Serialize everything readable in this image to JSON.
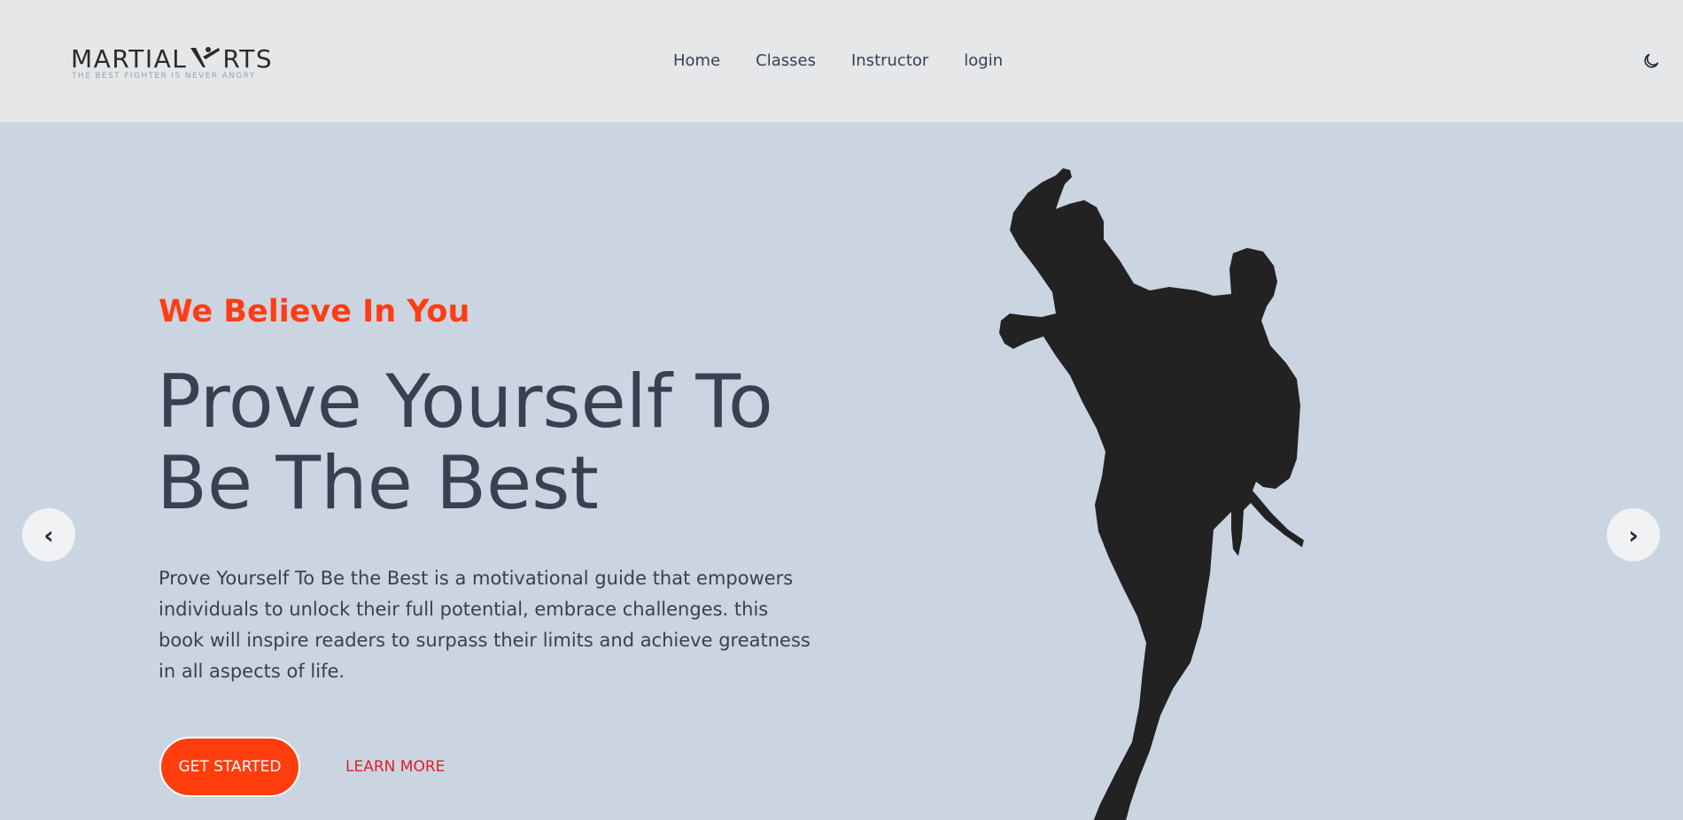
{
  "header": {
    "logo": {
      "text_left": "MARTIAL",
      "text_right": "RTS",
      "tagline": "THE BEST FIGHTER IS NEVER ANGRY"
    },
    "nav": [
      {
        "label": "Home"
      },
      {
        "label": "Classes"
      },
      {
        "label": "Instructor"
      },
      {
        "label": "login"
      }
    ],
    "theme_toggle_icon": "moon-icon"
  },
  "hero": {
    "eyebrow": "We Believe In You",
    "headline": "Prove Yourself To Be The Best",
    "description": "Prove Yourself To Be the Best is a motivational guide that empowers individuals to unlock their full potential, embrace challenges. this book will inspire readers to surpass their limits and achieve greatness in all aspects of life.",
    "primary_button": "GET STARTED",
    "secondary_button": "LEARN MORE",
    "image_icon": "karate-kick-silhouette",
    "prev_arrow": "‹",
    "next_arrow": "›"
  },
  "colors": {
    "header_bg": "#e5e7e8",
    "hero_bg": "#cbd5e1",
    "accent": "#ff3d14",
    "text": "#374151",
    "link": "#e11d2b",
    "silhouette": "#222222"
  }
}
